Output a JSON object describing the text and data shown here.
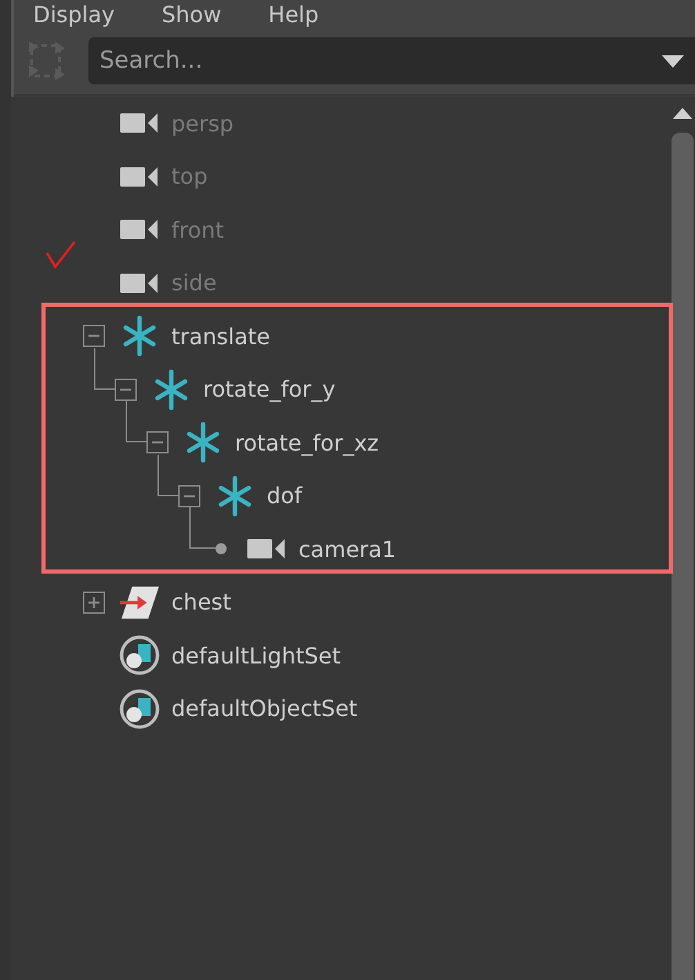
{
  "menu": [
    {
      "label": "Display"
    },
    {
      "label": "Show"
    },
    {
      "label": "Help"
    }
  ],
  "search": {
    "placeholder": "Search..."
  },
  "tree": [
    {
      "label": "persp",
      "kind": "camera",
      "dimmed": true
    },
    {
      "label": "top",
      "kind": "camera",
      "dimmed": true
    },
    {
      "label": "front",
      "kind": "camera",
      "dimmed": true
    },
    {
      "label": "side",
      "kind": "camera",
      "dimmed": true
    },
    {
      "label": "translate",
      "kind": "transform",
      "dimmed": false,
      "expanded": true,
      "children": [
        {
          "label": "rotate_for_y",
          "kind": "transform",
          "dimmed": false,
          "expanded": true,
          "children": [
            {
              "label": "rotate_for_xz",
              "kind": "transform",
              "dimmed": false,
              "expanded": true,
              "children": [
                {
                  "label": "dof",
                  "kind": "transform",
                  "dimmed": false,
                  "expanded": true,
                  "children": [
                    {
                      "label": "camera1",
                      "kind": "camera",
                      "dimmed": false
                    }
                  ]
                }
              ]
            }
          ]
        }
      ]
    },
    {
      "label": "chest",
      "kind": "joint",
      "dimmed": false,
      "expanded": false
    },
    {
      "label": "defaultLightSet",
      "kind": "set",
      "dimmed": false
    },
    {
      "label": "defaultObjectSet",
      "kind": "set",
      "dimmed": false
    }
  ]
}
